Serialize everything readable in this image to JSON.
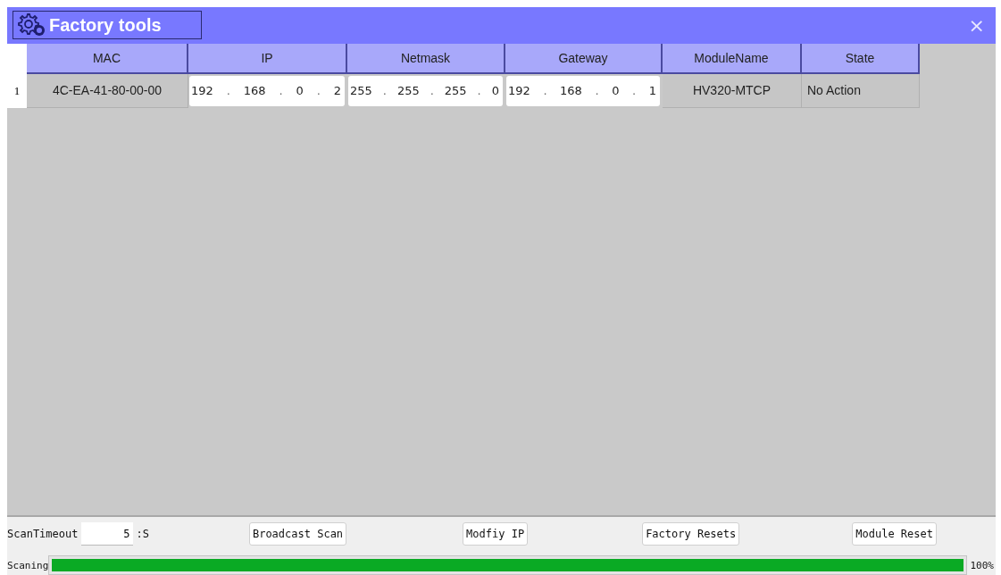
{
  "window": {
    "title": "Factory tools",
    "close": "×"
  },
  "table": {
    "columns": [
      "MAC",
      "IP",
      "Netmask",
      "Gateway",
      "ModuleName",
      "State"
    ],
    "separator": ".",
    "rows": [
      {
        "number": "1",
        "mac": "4C-EA-41-80-00-00",
        "ip": [
          "192",
          "168",
          "0",
          "2"
        ],
        "netmask": [
          "255",
          "255",
          "255",
          "0"
        ],
        "gateway": [
          "192",
          "168",
          "0",
          "1"
        ],
        "module_name": "HV320-MTCP",
        "state": "No Action"
      }
    ]
  },
  "controls": {
    "scan_timeout_label": "ScanTimeout",
    "scan_timeout": "5",
    "unit": ":S",
    "buttons": [
      "Broadcast Scan",
      "Modfiy IP",
      "Factory Resets",
      "Module Reset"
    ]
  },
  "status": {
    "label": "Scaning",
    "level": 1,
    "reading": "100%"
  }
}
